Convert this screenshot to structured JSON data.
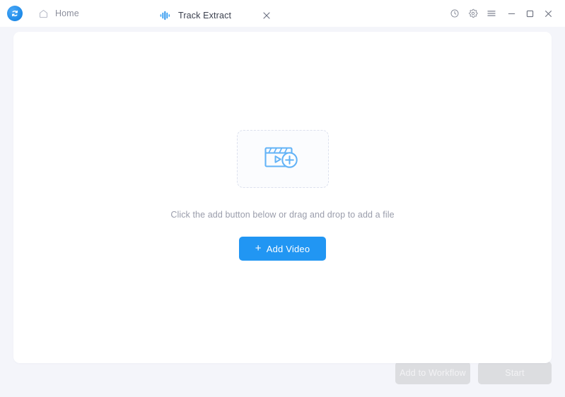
{
  "window": {
    "logo_icon": "app-logo-refresh-icon",
    "controls": [
      {
        "name": "history-icon",
        "label": "History"
      },
      {
        "name": "gear-icon",
        "label": "Settings"
      },
      {
        "name": "menu-icon",
        "label": "Menu"
      },
      {
        "name": "minimize-icon",
        "label": "Minimize"
      },
      {
        "name": "maximize-icon",
        "label": "Maximize"
      },
      {
        "name": "close-icon",
        "label": "Close"
      }
    ]
  },
  "nav": {
    "home_label": "Home",
    "home_icon": "home-icon"
  },
  "tabs": [
    {
      "label": "Track Extract",
      "icon": "audio-waveform-icon",
      "active": true,
      "close_icon": "close-icon"
    }
  ],
  "main": {
    "dropzone": {
      "icon": "add-video-clapperboard-icon"
    },
    "hint_text": "Click the add button below or drag and drop to add a file",
    "add_button": {
      "label": "Add Video",
      "plus": "+"
    }
  },
  "footer": {
    "add_to_workflow_label": "Add to Workflow",
    "start_label": "Start"
  },
  "colors": {
    "accent": "#2196f3",
    "page_bg": "#f4f5fa",
    "card_bg": "#ffffff",
    "disabled_btn": "#dcdde0",
    "hint_text": "#9a9dab",
    "tab_text": "#3a3f4d"
  }
}
